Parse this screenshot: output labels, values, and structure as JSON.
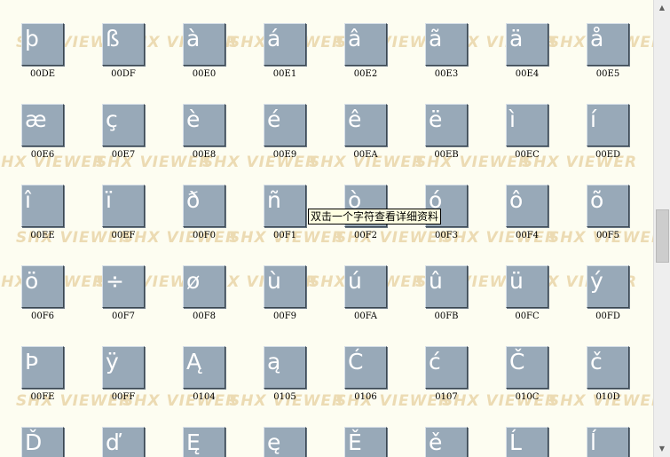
{
  "watermark_text": "SHX VIEWER",
  "tooltip": "双击一个字符查看详细资料",
  "scrollbar": {
    "up_arrow": "▲",
    "down_arrow": "▼"
  },
  "tiles": [
    {
      "glyph": "þ",
      "code": "00DE"
    },
    {
      "glyph": "ß",
      "code": "00DF"
    },
    {
      "glyph": "à",
      "code": "00E0"
    },
    {
      "glyph": "á",
      "code": "00E1"
    },
    {
      "glyph": "â",
      "code": "00E2"
    },
    {
      "glyph": "ã",
      "code": "00E3"
    },
    {
      "glyph": "ä",
      "code": "00E4"
    },
    {
      "glyph": "å",
      "code": "00E5"
    },
    {
      "glyph": "æ",
      "code": "00E6"
    },
    {
      "glyph": "ç",
      "code": "00E7"
    },
    {
      "glyph": "è",
      "code": "00E8"
    },
    {
      "glyph": "é",
      "code": "00E9"
    },
    {
      "glyph": "ê",
      "code": "00EA"
    },
    {
      "glyph": "ë",
      "code": "00EB"
    },
    {
      "glyph": "ì",
      "code": "00EC"
    },
    {
      "glyph": "í",
      "code": "00ED"
    },
    {
      "glyph": "î",
      "code": "00EE"
    },
    {
      "glyph": "ï",
      "code": "00EF"
    },
    {
      "glyph": "ð",
      "code": "00F0"
    },
    {
      "glyph": "ñ",
      "code": "00F1"
    },
    {
      "glyph": "ò",
      "code": "00F2"
    },
    {
      "glyph": "ó",
      "code": "00F3"
    },
    {
      "glyph": "ô",
      "code": "00F4"
    },
    {
      "glyph": "õ",
      "code": "00F5"
    },
    {
      "glyph": "ö",
      "code": "00F6"
    },
    {
      "glyph": "÷",
      "code": "00F7"
    },
    {
      "glyph": "ø",
      "code": "00F8"
    },
    {
      "glyph": "ù",
      "code": "00F9"
    },
    {
      "glyph": "ú",
      "code": "00FA"
    },
    {
      "glyph": "û",
      "code": "00FB"
    },
    {
      "glyph": "ü",
      "code": "00FC"
    },
    {
      "glyph": "ý",
      "code": "00FD"
    },
    {
      "glyph": "Þ",
      "code": "00FE"
    },
    {
      "glyph": "ÿ",
      "code": "00FF"
    },
    {
      "glyph": "Ą",
      "code": "0104"
    },
    {
      "glyph": "ą",
      "code": "0105"
    },
    {
      "glyph": "Ć",
      "code": "0106"
    },
    {
      "glyph": "ć",
      "code": "0107"
    },
    {
      "glyph": "Č",
      "code": "010C"
    },
    {
      "glyph": "č",
      "code": "010D"
    },
    {
      "glyph": "Ď",
      "code": ""
    },
    {
      "glyph": "ď",
      "code": ""
    },
    {
      "glyph": "Ę",
      "code": ""
    },
    {
      "glyph": "ę",
      "code": ""
    },
    {
      "glyph": "Ě",
      "code": ""
    },
    {
      "glyph": "ě",
      "code": ""
    },
    {
      "glyph": "Ĺ",
      "code": ""
    },
    {
      "glyph": "ĺ",
      "code": ""
    }
  ]
}
